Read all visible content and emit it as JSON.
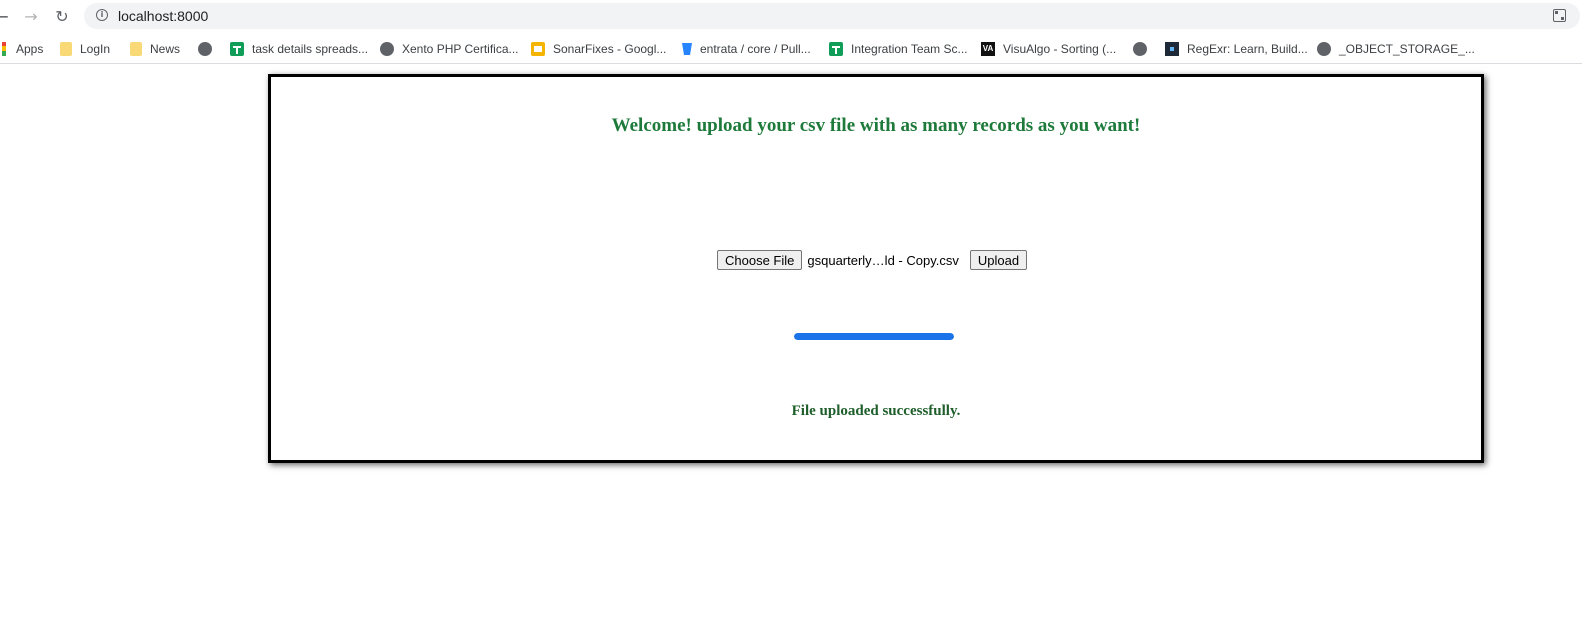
{
  "browser": {
    "url": "localhost:8000",
    "nav": {
      "back_icon": "back-arrow-icon",
      "forward_icon": "forward-arrow-icon",
      "reload_icon": "reload-icon"
    },
    "bookmarks": [
      {
        "label": "Apps",
        "icon": "apps-grid-icon"
      },
      {
        "label": "LogIn",
        "icon": "folder-icon"
      },
      {
        "label": "News",
        "icon": "folder-icon"
      },
      {
        "label": "",
        "icon": "globe-icon"
      },
      {
        "label": "task details spreads...",
        "icon": "sheets-icon"
      },
      {
        "label": "Xento PHP Certifica...",
        "icon": "globe-icon"
      },
      {
        "label": "SonarFixes - Googl...",
        "icon": "slides-icon"
      },
      {
        "label": "entrata / core / Pull...",
        "icon": "bitbucket-icon"
      },
      {
        "label": "Integration Team Sc...",
        "icon": "sheets-icon"
      },
      {
        "label": "VisuAlgo - Sorting (...",
        "icon": "visualgo-icon"
      },
      {
        "label": "",
        "icon": "globe-icon"
      },
      {
        "label": "RegExr: Learn, Build...",
        "icon": "regexr-icon"
      },
      {
        "label": "_OBJECT_STORAGE_...",
        "icon": "globe-icon"
      }
    ]
  },
  "page": {
    "heading": "Welcome! upload your csv file with as many records as you want!",
    "file_input": {
      "button_label": "Choose File",
      "selected_file": "gsquarterly…ld - Copy.csv"
    },
    "upload_label": "Upload",
    "progress": {
      "fraction": 1.0,
      "color": "#1a73e8"
    },
    "status": "File uploaded successfully.",
    "heading_color": "#1e7a3a"
  }
}
